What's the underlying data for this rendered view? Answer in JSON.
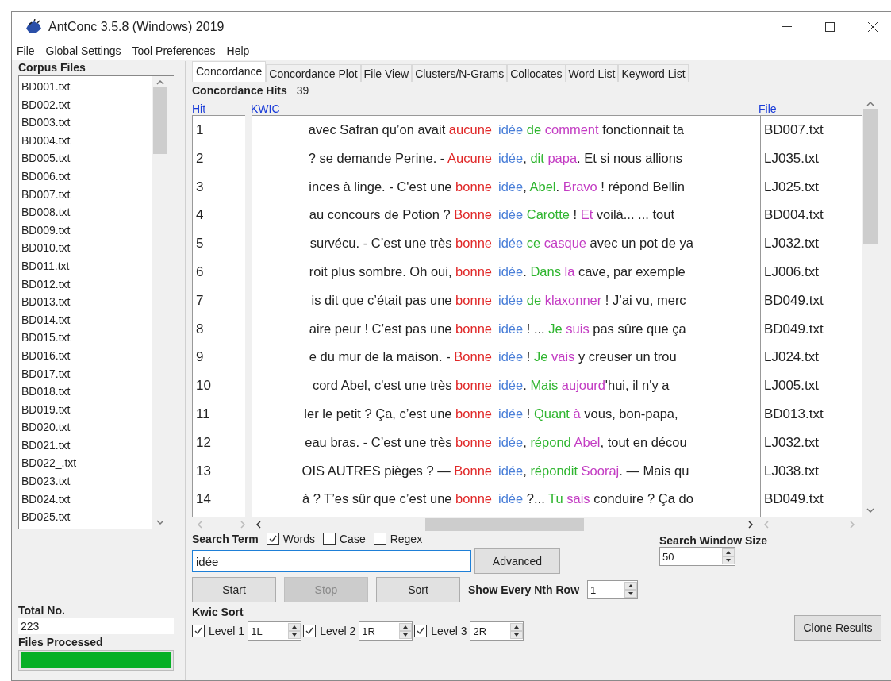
{
  "window": {
    "title": "AntConc 3.5.8 (Windows) 2019"
  },
  "menu": [
    "File",
    "Global Settings",
    "Tool Preferences",
    "Help"
  ],
  "sidebar": {
    "heading": "Corpus Files",
    "files": [
      "BD001.txt",
      "BD002.txt",
      "BD003.txt",
      "BD004.txt",
      "BD005.txt",
      "BD006.txt",
      "BD007.txt",
      "BD008.txt",
      "BD009.txt",
      "BD010.txt",
      "BD011.txt",
      "BD012.txt",
      "BD013.txt",
      "BD014.txt",
      "BD015.txt",
      "BD016.txt",
      "BD017.txt",
      "BD018.txt",
      "BD019.txt",
      "BD020.txt",
      "BD021.txt",
      "BD022_.txt",
      "BD023.txt",
      "BD024.txt",
      "BD025.txt"
    ],
    "total_label": "Total No.",
    "total": "223",
    "processed_label": "Files Processed",
    "progress": {
      "level": 1
    }
  },
  "tabs": [
    {
      "label": "Concordance",
      "selected": true
    },
    {
      "label": "Concordance Plot",
      "selected": false
    },
    {
      "label": "File View",
      "selected": false
    },
    {
      "label": "Clusters/N-Grams",
      "selected": false
    },
    {
      "label": "Collocates",
      "selected": false
    },
    {
      "label": "Word List",
      "selected": false
    },
    {
      "label": "Keyword List",
      "selected": false
    }
  ],
  "hits": {
    "label": "Concordance Hits",
    "count": "39"
  },
  "table": {
    "columns": [
      "Hit",
      "KWIC",
      "File"
    ],
    "rows": [
      {
        "hit": "1",
        "left": [
          {
            "text": "avec Safran qu’on avait "
          },
          {
            "text": "aucune",
            "color": "#e02828"
          }
        ],
        "right": [
          {
            "text": "idée ",
            "color": "#4a7fd8"
          },
          {
            "text": "de ",
            "color": "#2fb52f"
          },
          {
            "text": "comment",
            "color": "#c33cc3"
          },
          {
            "text": " fonctionnait ta"
          }
        ],
        "file": "BD007.txt"
      },
      {
        "hit": "2",
        "left": [
          {
            "text": "? se demande Perine. - "
          },
          {
            "text": "Aucune",
            "color": "#e02828"
          }
        ],
        "right": [
          {
            "text": "idée",
            "color": "#4a7fd8"
          },
          {
            "text": ", "
          },
          {
            "text": "dit ",
            "color": "#2fb52f"
          },
          {
            "text": "papa",
            "color": "#c33cc3"
          },
          {
            "text": ". Et si nous allions"
          }
        ],
        "file": "LJ035.txt"
      },
      {
        "hit": "3",
        "left": [
          {
            "text": "inces à linge. - C'est une "
          },
          {
            "text": "bonne",
            "color": "#e02828"
          }
        ],
        "right": [
          {
            "text": "idée",
            "color": "#4a7fd8",
            "after": ", "
          },
          {
            "text": "Abel",
            "color": "#2fb52f",
            "after": ". "
          },
          {
            "text": "Bravo",
            "color": "#c33cc3"
          },
          {
            "text": " ! répond Bellin"
          }
        ],
        "file": "LJ025.txt"
      },
      {
        "hit": "4",
        "left": [
          {
            "text": "au concours de  Potion ? "
          },
          {
            "text": "Bonne",
            "color": "#e02828"
          }
        ],
        "right": [
          {
            "text": "idée ",
            "color": "#4a7fd8"
          },
          {
            "text": "Carotte",
            "color": "#2fb52f"
          },
          {
            "text": " !  "
          },
          {
            "text": "Et",
            "color": "#c33cc3"
          },
          {
            "text": " voilà...  ... tout"
          }
        ],
        "file": "BD004.txt"
      },
      {
        "hit": "5",
        "left": [
          {
            "text": "survécu. - C’est une très "
          },
          {
            "text": "bonne",
            "color": "#e02828"
          }
        ],
        "right": [
          {
            "text": "idée ",
            "color": "#4a7fd8"
          },
          {
            "text": "ce ",
            "color": "#2fb52f"
          },
          {
            "text": "casque",
            "color": "#c33cc3"
          },
          {
            "text": " avec un pot de ya"
          }
        ],
        "file": "LJ032.txt"
      },
      {
        "hit": "6",
        "left": [
          {
            "text": "roit plus sombre. Oh oui, "
          },
          {
            "text": "bonne",
            "color": "#e02828"
          }
        ],
        "right": [
          {
            "text": "idée",
            "color": "#4a7fd8"
          },
          {
            "text": ". "
          },
          {
            "text": "Dans ",
            "color": "#2fb52f"
          },
          {
            "text": "la",
            "color": "#c33cc3"
          },
          {
            "text": " cave, par exemple"
          }
        ],
        "file": "LJ006.txt"
      },
      {
        "hit": "7",
        "left": [
          {
            "text": "is dit que c’était pas une "
          },
          {
            "text": "bonne",
            "color": "#e02828"
          }
        ],
        "right": [
          {
            "text": "idée ",
            "color": "#4a7fd8"
          },
          {
            "text": "de ",
            "color": "#2fb52f"
          },
          {
            "text": "klaxonner",
            "color": "#c33cc3"
          },
          {
            "text": " ! J’ai vu, merc"
          }
        ],
        "file": "BD049.txt"
      },
      {
        "hit": "8",
        "left": [
          {
            "text": "aire peur ! C’est pas une "
          },
          {
            "text": "bonne",
            "color": "#e02828"
          }
        ],
        "right": [
          {
            "text": "idée",
            "color": "#4a7fd8"
          },
          {
            "text": " ! ... "
          },
          {
            "text": "Je ",
            "color": "#2fb52f"
          },
          {
            "text": "suis",
            "color": "#c33cc3"
          },
          {
            "text": " pas sûre que ça"
          }
        ],
        "file": "BD049.txt"
      },
      {
        "hit": "9",
        "left": [
          {
            "text": "e du mur de la maison. - "
          },
          {
            "text": "Bonne",
            "color": "#e02828"
          }
        ],
        "right": [
          {
            "text": "idée",
            "color": "#4a7fd8"
          },
          {
            "text": " ! "
          },
          {
            "text": "Je ",
            "color": "#2fb52f"
          },
          {
            "text": "vais",
            "color": "#c33cc3"
          },
          {
            "text": " y creuser un trou"
          }
        ],
        "file": "LJ024.txt"
      },
      {
        "hit": "10",
        "left": [
          {
            "text": "cord Abel, c'est une très "
          },
          {
            "text": "bonne",
            "color": "#e02828"
          }
        ],
        "right": [
          {
            "text": "idée",
            "color": "#4a7fd8"
          },
          {
            "text": ".   "
          },
          {
            "text": "Mais ",
            "color": "#2fb52f"
          },
          {
            "text": "aujourd",
            "color": "#c33cc3"
          },
          {
            "text": "'hui, il n'y a"
          }
        ],
        "file": "LJ005.txt"
      },
      {
        "hit": "11",
        "left": [
          {
            "text": "ler le petit ? Ça, c’est une "
          },
          {
            "text": "bonne",
            "color": "#e02828"
          }
        ],
        "right": [
          {
            "text": "idée",
            "color": "#4a7fd8"
          },
          {
            "text": " !  "
          },
          {
            "text": "Quant ",
            "color": "#2fb52f"
          },
          {
            "text": "à",
            "color": "#c33cc3"
          },
          {
            "text": " vous, bon-papa,"
          }
        ],
        "file": "BD013.txt"
      },
      {
        "hit": "12",
        "left": [
          {
            "text": "eau bras. - C’est une très "
          },
          {
            "text": "bonne",
            "color": "#e02828"
          }
        ],
        "right": [
          {
            "text": "idée",
            "color": "#4a7fd8"
          },
          {
            "text": ", "
          },
          {
            "text": "répond ",
            "color": "#2fb52f"
          },
          {
            "text": "Abel",
            "color": "#c33cc3"
          },
          {
            "text": ", tout en décou"
          }
        ],
        "file": "LJ032.txt"
      },
      {
        "hit": "13",
        "left": [
          {
            "text": "OIS AUTRES pièges ? — "
          },
          {
            "text": "Bonne",
            "color": "#e02828"
          }
        ],
        "right": [
          {
            "text": "idée",
            "color": "#4a7fd8",
            "after": ", "
          },
          {
            "text": "répondit ",
            "color": "#2fb52f"
          },
          {
            "text": "Sooraj",
            "color": "#c33cc3"
          },
          {
            "text": ". — Mais qu"
          }
        ],
        "file": "LJ038.txt"
      },
      {
        "hit": "14",
        "left": [
          {
            "text": "à ? T’es sûr que c’est une "
          },
          {
            "text": "bonne",
            "color": "#e02828"
          }
        ],
        "right": [
          {
            "text": "idée",
            "color": "#4a7fd8"
          },
          {
            "text": " ?... "
          },
          {
            "text": "Tu ",
            "color": "#2fb52f"
          },
          {
            "text": "sais",
            "color": "#c33cc3"
          },
          {
            "text": " conduire ? Ça do"
          }
        ],
        "file": "BD049.txt"
      }
    ]
  },
  "search": {
    "label": "Search Term",
    "options": [
      {
        "label": "Words",
        "checked": true
      },
      {
        "label": "Case",
        "checked": false
      },
      {
        "label": "Regex",
        "checked": false
      }
    ],
    "value": "idée",
    "advanced": "Advanced"
  },
  "buttons": [
    {
      "label": "Start",
      "disabled": false
    },
    {
      "label": "Stop",
      "disabled": true
    },
    {
      "label": "Sort",
      "disabled": false
    }
  ],
  "nth_row": {
    "label": "Show Every Nth Row",
    "value": "1"
  },
  "window_size": {
    "label": "Search Window Size",
    "value": "50"
  },
  "kwic_sort": {
    "label": "Kwic Sort",
    "levels": [
      {
        "label": "Level 1",
        "checked": true,
        "value": "1L"
      },
      {
        "label": "Level 2",
        "checked": true,
        "value": "1R"
      },
      {
        "label": "Level 3",
        "checked": true,
        "value": "2R"
      }
    ]
  },
  "clone": "Clone Results"
}
